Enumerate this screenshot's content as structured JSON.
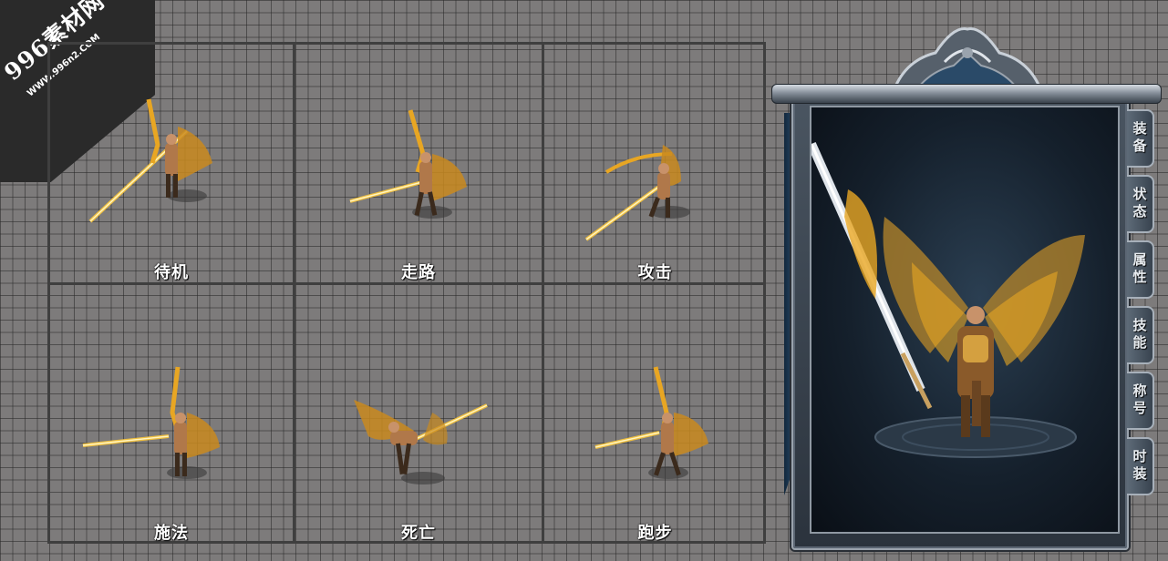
{
  "watermark": {
    "title": "996素材网",
    "url": "WWW.996n2.COM"
  },
  "animations": [
    {
      "label": "待机"
    },
    {
      "label": "走路"
    },
    {
      "label": "攻击"
    },
    {
      "label": "施法"
    },
    {
      "label": "死亡"
    },
    {
      "label": "跑步"
    }
  ],
  "panel": {
    "tabs": [
      {
        "label": "装备"
      },
      {
        "label": "状态"
      },
      {
        "label": "属性"
      },
      {
        "label": "技能"
      },
      {
        "label": "称号"
      },
      {
        "label": "时装"
      }
    ]
  },
  "colors": {
    "grid_bg": "#7d7b7b",
    "grid_line": "#3f3f3f",
    "gold": "#e8a623",
    "panel_steel": "#8f98a2",
    "panel_dark": "#15202c"
  }
}
